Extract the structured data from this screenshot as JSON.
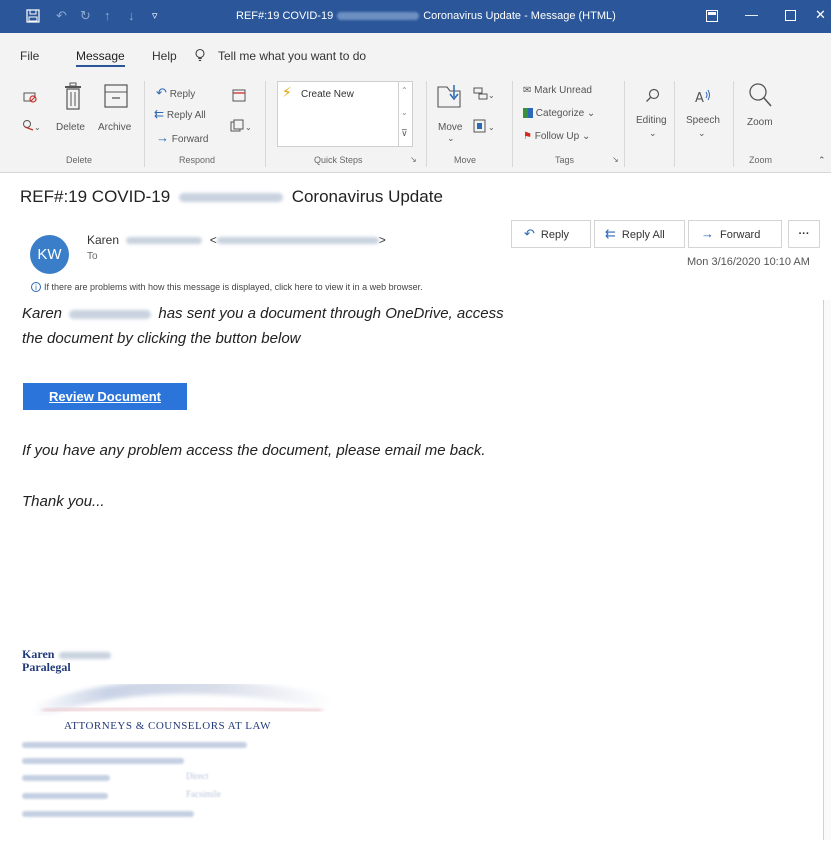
{
  "titlebar": {
    "title_prefix": "REF#:19 COVID-19",
    "title_suffix": "Coronavirus Update  -  Message (HTML)"
  },
  "tabs": [
    {
      "label": "File"
    },
    {
      "label": "Message"
    },
    {
      "label": "Help"
    }
  ],
  "tellme": {
    "label": "Tell me what you want to do"
  },
  "ribbon": {
    "delete_group": {
      "delete_label": "Delete",
      "archive_label": "Archive",
      "group_label": "Delete"
    },
    "respond_group": {
      "reply_label": "Reply",
      "reply_all_label": "Reply All",
      "forward_label": "Forward",
      "group_label": "Respond"
    },
    "quick_steps": {
      "create_new_label": "Create New",
      "group_label": "Quick Steps"
    },
    "move_group": {
      "move_label": "Move",
      "group_label": "Move"
    },
    "tags_group": {
      "mark_unread_label": "Mark Unread",
      "categorize_label": "Categorize",
      "follow_up_label": "Follow Up",
      "group_label": "Tags"
    },
    "editing_label": "Editing",
    "speech_label": "Speech",
    "zoom_group": {
      "zoom_label": "Zoom",
      "group_label": "Zoom"
    }
  },
  "message": {
    "subject_prefix": "REF#:19 COVID-19",
    "subject_suffix": "Coronavirus Update",
    "avatar_initials": "KW",
    "sender_first": "Karen",
    "to_label": "To",
    "date": "Mon 3/16/2020 10:10 AM",
    "info_text": "If there are problems with how this message is displayed, click here to view it in a web browser.",
    "actions": {
      "reply": "Reply",
      "reply_all": "Reply All",
      "forward": "Forward",
      "more": "···"
    }
  },
  "body": {
    "line1_a": "Karen",
    "line1_b": "has sent you a document through OneDrive, access",
    "line2": "the document by clicking the button below",
    "review_button": "Review Document",
    "line3": "If you have any problem access the document, please email me back.",
    "line4": "Thank you..."
  },
  "signature": {
    "name_first": "Karen",
    "role": "Paralegal",
    "firm": "Attorneys & Counselors At Law",
    "firm_small_caps": "ATTORNEYS & COUNSELORS AT LAW",
    "phone_1_label": "Direct",
    "phone_2_label": "Facsimile"
  },
  "colors": {
    "titlebar": "#2b579a",
    "accent_blue": "#2b74d9",
    "avatar": "#3a7ec9",
    "signature_navy": "#233a7a"
  }
}
